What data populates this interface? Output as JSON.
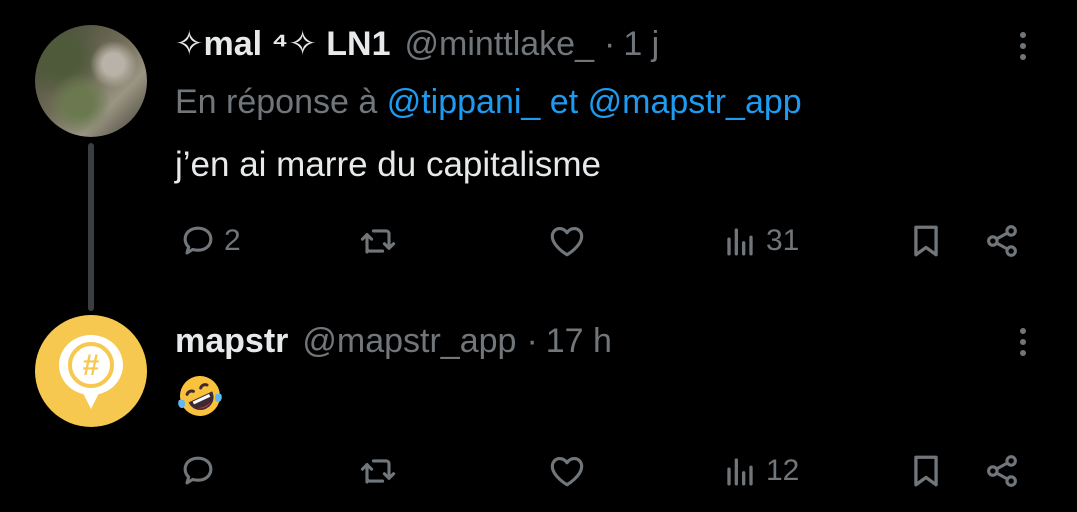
{
  "tweets": [
    {
      "name": "✧mal ⁴✧ LN1",
      "handle": "@minttlake_",
      "separator": "·",
      "time": "1 j",
      "reply_prefix": "En réponse à",
      "reply_mentions": [
        "@tippani_",
        "@mapstr_app"
      ],
      "reply_joiner": "et",
      "text": "j’en ai marre du capitalisme",
      "replies": "2",
      "reposts": "",
      "likes": "",
      "views": "31"
    },
    {
      "name": "mapstr",
      "handle": "@mapstr_app",
      "separator": "·",
      "time": "17 h",
      "text": "🤣",
      "replies": "",
      "reposts": "",
      "likes": "",
      "views": "12",
      "avatar_glyph": "#"
    }
  ],
  "colors": {
    "background": "#000000",
    "text": "#e7e9ea",
    "muted": "#71767b",
    "link": "#1d9bf0",
    "brand_avatar": "#f6c850"
  }
}
